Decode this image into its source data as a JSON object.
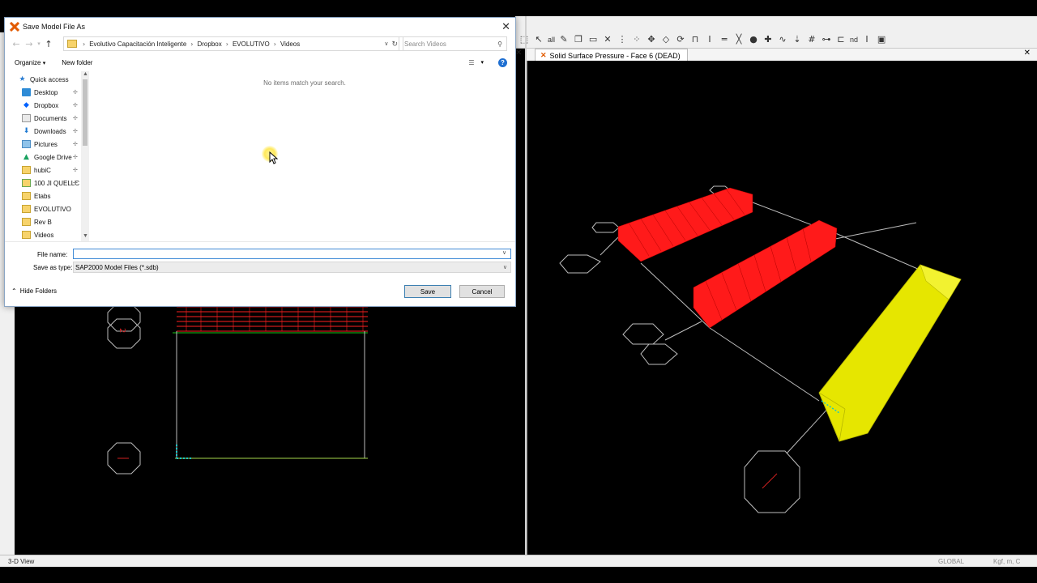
{
  "dialog": {
    "title": "Save Model File As",
    "address": {
      "crumbs": [
        "Evolutivo Capacitación Inteligente",
        "Dropbox",
        "EVOLUTIVO",
        "Videos"
      ]
    },
    "search_placeholder": "Search Videos",
    "commands": {
      "organize": "Organize",
      "new_folder": "New folder"
    },
    "nav": {
      "quick_access": "Quick access",
      "items": [
        {
          "label": "Desktop",
          "icon": "desktop-icon",
          "pinned": true
        },
        {
          "label": "Dropbox",
          "icon": "dropbox-icon",
          "pinned": true
        },
        {
          "label": "Documents",
          "icon": "documents-icon",
          "pinned": true
        },
        {
          "label": "Downloads",
          "icon": "downloads-icon",
          "pinned": true
        },
        {
          "label": "Pictures",
          "icon": "pictures-icon",
          "pinned": true
        },
        {
          "label": "Google Drive",
          "icon": "google-drive-icon",
          "pinned": true
        },
        {
          "label": "hubiC",
          "icon": "folder-icon",
          "pinned": true
        },
        {
          "label": "100 JI QUELLC",
          "icon": "network-folder-icon",
          "pinned": true
        },
        {
          "label": "Etabs",
          "icon": "folder-icon",
          "pinned": false
        },
        {
          "label": "EVOLUTIVO",
          "icon": "folder-icon",
          "pinned": false
        },
        {
          "label": "Rev B",
          "icon": "folder-icon",
          "pinned": false
        },
        {
          "label": "Videos",
          "icon": "folder-icon",
          "pinned": false
        }
      ]
    },
    "empty_message": "No items match your search.",
    "file_name_label": "File name:",
    "file_name_value": "",
    "save_as_type_label": "Save as type:",
    "save_as_type_value": "SAP2000 Model Files (*.sdb)",
    "hide_folders": "Hide Folders",
    "save_button": "Save",
    "cancel_button": "Cancel"
  },
  "app": {
    "right_view_tab": "Solid Surface Pressure - Face 6 (DEAD)",
    "toolbar_text": [
      "all",
      "nd"
    ],
    "status_left": "3-D View",
    "status_coord": "GLOBAL",
    "status_units": "Kgf, m, C"
  },
  "colors": {
    "solid_red": "#ff1a1a",
    "solid_yellow": "#e6e600",
    "grid_green": "#19c619",
    "line_gray": "#bdbdbd"
  }
}
